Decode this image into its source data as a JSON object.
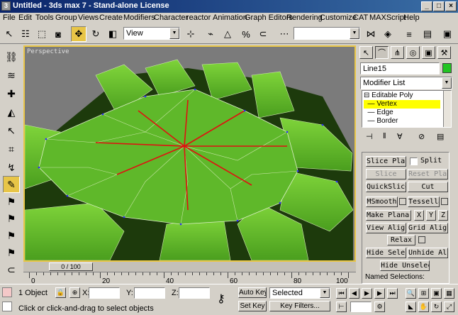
{
  "window": {
    "title": "Untitled - 3ds max 7 - Stand-alone License"
  },
  "menu": [
    "File",
    "Edit",
    "Tools",
    "Group",
    "Views",
    "Create",
    "Modifiers",
    "Character",
    "reactor",
    "Animation",
    "Graph Editors",
    "Rendering",
    "Customize",
    "CAT",
    "MAXScript",
    "Help"
  ],
  "toolbar": {
    "view_combo": "View"
  },
  "viewport": {
    "label": "Perspective"
  },
  "timeline": {
    "slider_label": "0 / 100",
    "ruler_labels": [
      "0",
      "20",
      "40",
      "60",
      "80",
      "100"
    ]
  },
  "command_panel": {
    "object_name": "Line15",
    "object_color": "#22c422",
    "modifier_list": "Modifier List",
    "stack": [
      "Editable Poly",
      "Vertex",
      "Edge",
      "Border"
    ],
    "selected_stack": "Vertex",
    "buttons": {
      "slice_plane": "Slice Plane",
      "split": "Split",
      "slice": "Slice",
      "reset_plane": "Reset Plane",
      "quickslice": "QuickSlice",
      "cut": "Cut",
      "msmooth": "MSmooth",
      "tessellate": "Tessellate",
      "make_planar": "Make Planar",
      "x": "X",
      "y": "Y",
      "z": "Z",
      "view_align": "View Align",
      "grid_align": "Grid Align",
      "relax": "Relax",
      "hide_selected": "Hide Selected",
      "unhide_all": "Unhide All",
      "hide_unselected": "Hide Unselected"
    },
    "named_selections": "Named Selections:"
  },
  "status": {
    "object_count": "1 Object",
    "x_label": "X:",
    "y_label": "Y:",
    "z_label": "Z:",
    "auto_key": "Auto Key",
    "set_key": "Set Key",
    "selected": "Selected",
    "key_filters": "Key Filters...",
    "prompt": "Click or click-and-drag to select objects"
  },
  "colors": {
    "accent": "#e8c547",
    "title_start": "#0a246a",
    "mesh": "#5fb82a",
    "edge_selected": "#e01010"
  }
}
